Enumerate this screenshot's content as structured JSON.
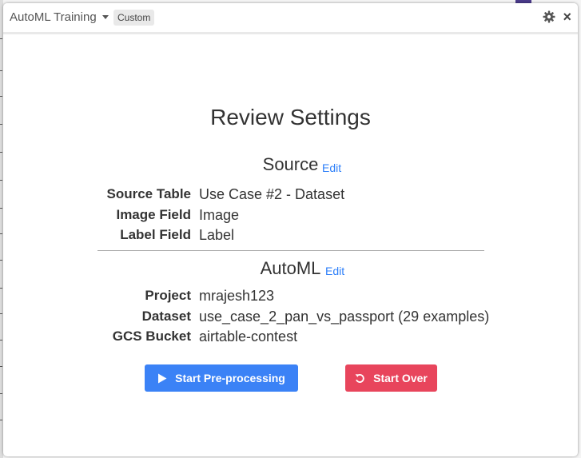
{
  "window": {
    "app_title": "AutoML Training",
    "badge": "Custom",
    "settings_icon": "gear-icon",
    "close_icon": "close-icon",
    "close_glyph": "×"
  },
  "page": {
    "heading": "Review Settings"
  },
  "source": {
    "title": "Source",
    "edit_label": "Edit",
    "rows": [
      {
        "label": "Source Table",
        "value": "Use Case #2 - Dataset"
      },
      {
        "label": "Image Field",
        "value": "Image"
      },
      {
        "label": "Label Field",
        "value": "Label"
      }
    ]
  },
  "automl": {
    "title": "AutoML",
    "edit_label": "Edit",
    "rows": [
      {
        "label": "Project",
        "value": "mrajesh123"
      },
      {
        "label": "Dataset",
        "value": "use_case_2_pan_vs_passport (29 examples)"
      },
      {
        "label": "GCS Bucket",
        "value": "airtable-contest"
      }
    ]
  },
  "actions": {
    "start_label": "Start Pre-processing",
    "start_icon": "play-icon",
    "start_color": "#3b82f6",
    "over_label": "Start Over",
    "over_icon": "undo-icon",
    "over_color": "#e8455c"
  },
  "colors": {
    "link": "#2d7ff9",
    "text": "#333333"
  }
}
